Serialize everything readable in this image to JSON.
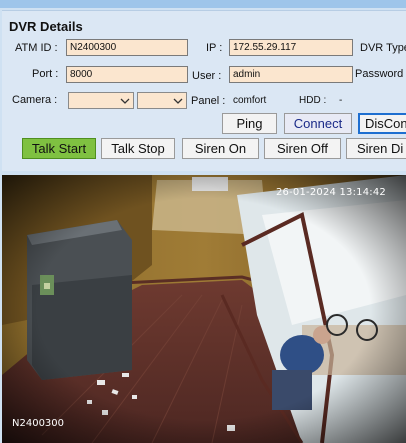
{
  "panel": {
    "title": "DVR Details",
    "atm_id_label": "ATM ID :",
    "atm_id_value": "N2400300",
    "ip_label": "IP :",
    "ip_value": "172.55.29.117",
    "dvr_type_label": "DVR Type",
    "port_label": "Port :",
    "port_value": "8000",
    "user_label": "User :",
    "user_value": "admin",
    "password_label": "Password",
    "camera_label": "Camera :",
    "panel_label": "Panel :",
    "panel_value": "comfort",
    "hdd_label": "HDD :",
    "hdd_value": "-"
  },
  "buttons": {
    "ping": "Ping",
    "connect": "Connect",
    "disconnect": "DisCon",
    "talk_start": "Talk Start",
    "talk_stop": "Talk Stop",
    "siren_on": "Siren On",
    "siren_off": "Siren Off",
    "siren_di": "Siren Di"
  },
  "feed": {
    "timestamp": "26-01-2024 13:14:42",
    "camera_id": "N2400300"
  },
  "colors": {
    "field_bg": "#fbe6cf",
    "talk_start_bg": "#7fc141",
    "panel_bg": "#dbe7f4"
  }
}
